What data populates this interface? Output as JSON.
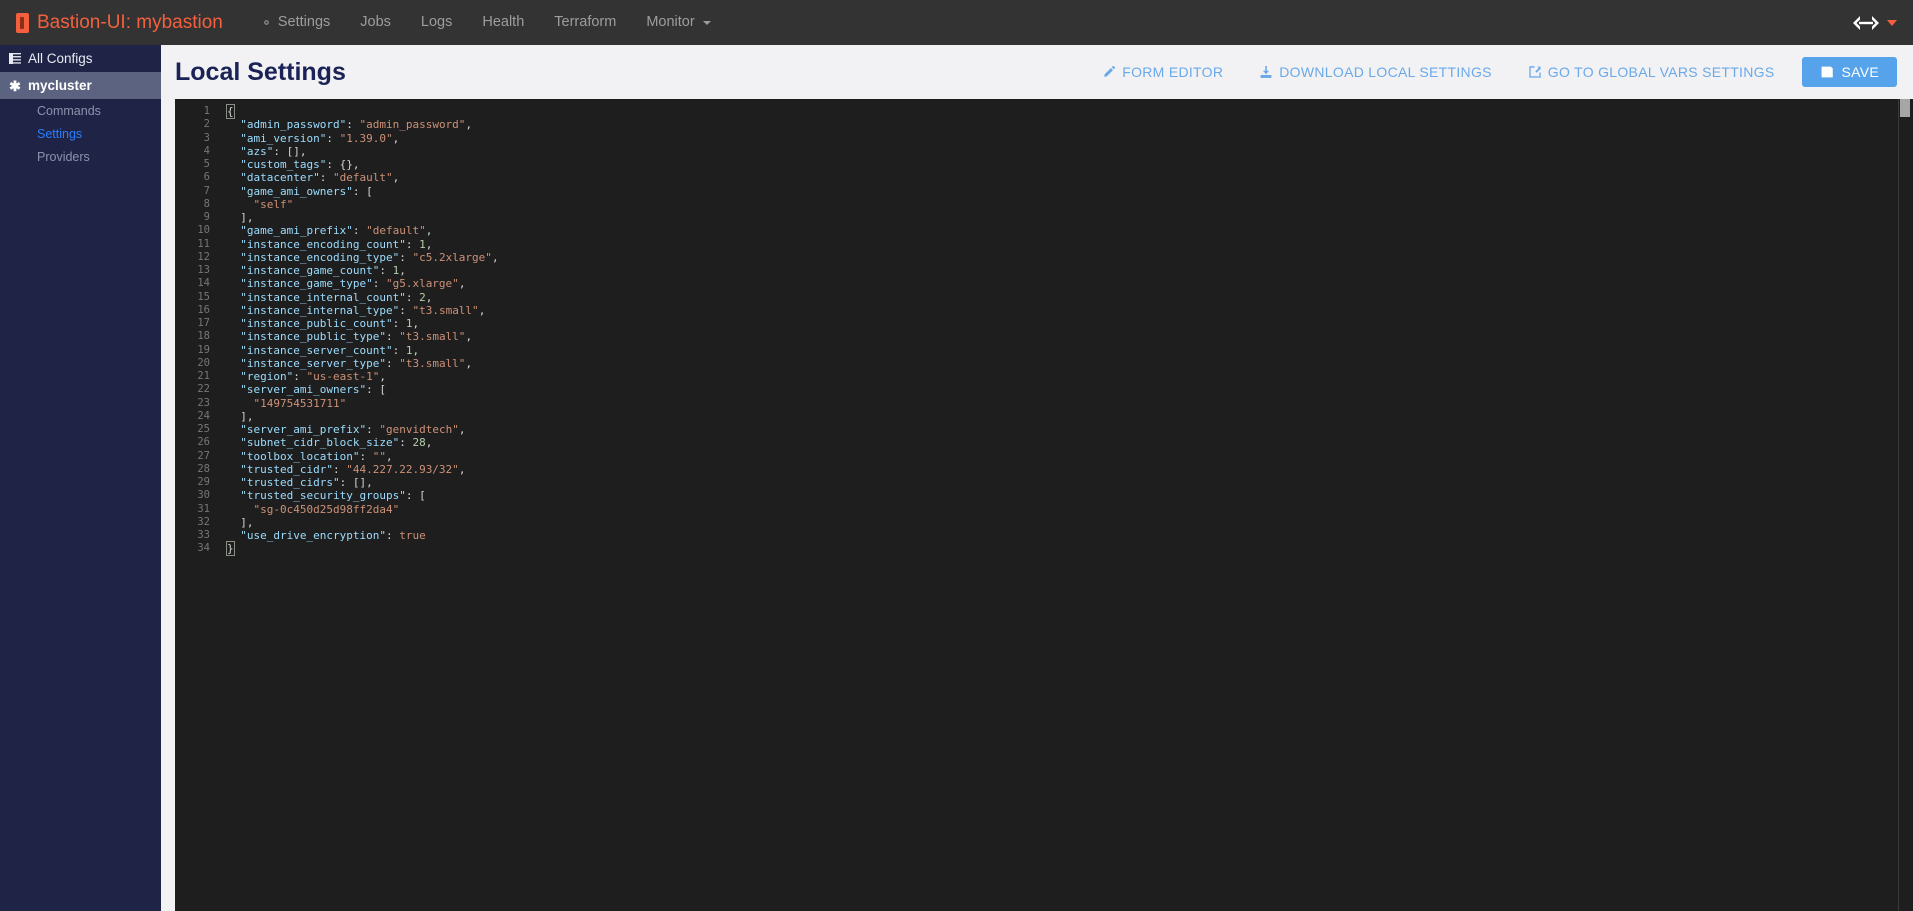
{
  "navbar": {
    "brand_icon": "bastion-logo-icon",
    "brand": "Bastion-UI: mybastion",
    "links": [
      {
        "label": "Settings",
        "icon": "gear-icon",
        "has_caret": false
      },
      {
        "label": "Jobs",
        "icon": null,
        "has_caret": false
      },
      {
        "label": "Logs",
        "icon": null,
        "has_caret": false
      },
      {
        "label": "Health",
        "icon": null,
        "has_caret": false
      },
      {
        "label": "Terraform",
        "icon": null,
        "has_caret": false
      },
      {
        "label": "Monitor",
        "icon": null,
        "has_caret": true
      }
    ],
    "right_logo_icon": "genvid-logo-icon",
    "right_caret_icon": "caret-down-icon",
    "background": "#333333",
    "brand_color": "#f4603e"
  },
  "sidebar": {
    "all_configs": {
      "label": "All Configs",
      "icon": "list-icon"
    },
    "cluster": {
      "label": "mycluster",
      "icon": "asterisk-icon",
      "active": true
    },
    "sub_items": [
      {
        "label": "Commands",
        "active": false
      },
      {
        "label": "Settings",
        "active": true
      },
      {
        "label": "Providers",
        "active": false
      }
    ],
    "background": "#1f2446",
    "active_background": "#5b6380",
    "active_link_color": "#2a7fff"
  },
  "header": {
    "title": "Local Settings",
    "actions": [
      {
        "label": "FORM EDITOR",
        "icon": "pencil-icon"
      },
      {
        "label": "DOWNLOAD LOCAL SETTINGS",
        "icon": "download-icon"
      },
      {
        "label": "GO TO GLOBAL VARS SETTINGS",
        "icon": "edit-square-icon"
      }
    ],
    "save": {
      "label": "SAVE",
      "icon": "floppy-disk-icon",
      "color": "#56a3eb"
    },
    "link_color": "#6aa9e9"
  },
  "editor": {
    "theme_background": "#1e1e1e",
    "line_number_color": "#767676",
    "key_color": "#9cdcfe",
    "string_color": "#ce9178",
    "number_color": "#b5cea8",
    "punctuation_color": "#d4d4d4",
    "total_lines": 34,
    "scrollbar": {
      "position": "top",
      "thumb_color": "#a6a6a6"
    },
    "lines": [
      {
        "n": 1,
        "indent": 0,
        "tokens": [
          {
            "t": "brack",
            "v": "{",
            "match": true
          }
        ]
      },
      {
        "n": 2,
        "indent": 1,
        "tokens": [
          {
            "t": "key",
            "v": "\"admin_password\""
          },
          {
            "t": "punc",
            "v": ": "
          },
          {
            "t": "str",
            "v": "\"admin_password\""
          },
          {
            "t": "punc",
            "v": ","
          }
        ]
      },
      {
        "n": 3,
        "indent": 1,
        "tokens": [
          {
            "t": "key",
            "v": "\"ami_version\""
          },
          {
            "t": "punc",
            "v": ": "
          },
          {
            "t": "str",
            "v": "\"1.39.0\""
          },
          {
            "t": "punc",
            "v": ","
          }
        ]
      },
      {
        "n": 4,
        "indent": 1,
        "tokens": [
          {
            "t": "key",
            "v": "\"azs\""
          },
          {
            "t": "punc",
            "v": ": "
          },
          {
            "t": "brack",
            "v": "[]"
          },
          {
            "t": "punc",
            "v": ","
          }
        ]
      },
      {
        "n": 5,
        "indent": 1,
        "tokens": [
          {
            "t": "key",
            "v": "\"custom_tags\""
          },
          {
            "t": "punc",
            "v": ": "
          },
          {
            "t": "brack",
            "v": "{}"
          },
          {
            "t": "punc",
            "v": ","
          }
        ]
      },
      {
        "n": 6,
        "indent": 1,
        "tokens": [
          {
            "t": "key",
            "v": "\"datacenter\""
          },
          {
            "t": "punc",
            "v": ": "
          },
          {
            "t": "str",
            "v": "\"default\""
          },
          {
            "t": "punc",
            "v": ","
          }
        ]
      },
      {
        "n": 7,
        "indent": 1,
        "tokens": [
          {
            "t": "key",
            "v": "\"game_ami_owners\""
          },
          {
            "t": "punc",
            "v": ": "
          },
          {
            "t": "brack",
            "v": "["
          }
        ]
      },
      {
        "n": 8,
        "indent": 2,
        "tokens": [
          {
            "t": "str",
            "v": "\"self\""
          }
        ]
      },
      {
        "n": 9,
        "indent": 1,
        "tokens": [
          {
            "t": "brack",
            "v": "]"
          },
          {
            "t": "punc",
            "v": ","
          }
        ]
      },
      {
        "n": 10,
        "indent": 1,
        "tokens": [
          {
            "t": "key",
            "v": "\"game_ami_prefix\""
          },
          {
            "t": "punc",
            "v": ": "
          },
          {
            "t": "str",
            "v": "\"default\""
          },
          {
            "t": "punc",
            "v": ","
          }
        ]
      },
      {
        "n": 11,
        "indent": 1,
        "tokens": [
          {
            "t": "key",
            "v": "\"instance_encoding_count\""
          },
          {
            "t": "punc",
            "v": ": "
          },
          {
            "t": "num",
            "v": "1"
          },
          {
            "t": "punc",
            "v": ","
          }
        ]
      },
      {
        "n": 12,
        "indent": 1,
        "tokens": [
          {
            "t": "key",
            "v": "\"instance_encoding_type\""
          },
          {
            "t": "punc",
            "v": ": "
          },
          {
            "t": "str",
            "v": "\"c5.2xlarge\""
          },
          {
            "t": "punc",
            "v": ","
          }
        ]
      },
      {
        "n": 13,
        "indent": 1,
        "tokens": [
          {
            "t": "key",
            "v": "\"instance_game_count\""
          },
          {
            "t": "punc",
            "v": ": "
          },
          {
            "t": "num",
            "v": "1"
          },
          {
            "t": "punc",
            "v": ","
          }
        ]
      },
      {
        "n": 14,
        "indent": 1,
        "tokens": [
          {
            "t": "key",
            "v": "\"instance_game_type\""
          },
          {
            "t": "punc",
            "v": ": "
          },
          {
            "t": "str",
            "v": "\"g5.xlarge\""
          },
          {
            "t": "punc",
            "v": ","
          }
        ]
      },
      {
        "n": 15,
        "indent": 1,
        "tokens": [
          {
            "t": "key",
            "v": "\"instance_internal_count\""
          },
          {
            "t": "punc",
            "v": ": "
          },
          {
            "t": "num",
            "v": "2"
          },
          {
            "t": "punc",
            "v": ","
          }
        ]
      },
      {
        "n": 16,
        "indent": 1,
        "tokens": [
          {
            "t": "key",
            "v": "\"instance_internal_type\""
          },
          {
            "t": "punc",
            "v": ": "
          },
          {
            "t": "str",
            "v": "\"t3.small\""
          },
          {
            "t": "punc",
            "v": ","
          }
        ]
      },
      {
        "n": 17,
        "indent": 1,
        "tokens": [
          {
            "t": "key",
            "v": "\"instance_public_count\""
          },
          {
            "t": "punc",
            "v": ": "
          },
          {
            "t": "num",
            "v": "1"
          },
          {
            "t": "punc",
            "v": ","
          }
        ]
      },
      {
        "n": 18,
        "indent": 1,
        "tokens": [
          {
            "t": "key",
            "v": "\"instance_public_type\""
          },
          {
            "t": "punc",
            "v": ": "
          },
          {
            "t": "str",
            "v": "\"t3.small\""
          },
          {
            "t": "punc",
            "v": ","
          }
        ]
      },
      {
        "n": 19,
        "indent": 1,
        "tokens": [
          {
            "t": "key",
            "v": "\"instance_server_count\""
          },
          {
            "t": "punc",
            "v": ": "
          },
          {
            "t": "num",
            "v": "1"
          },
          {
            "t": "punc",
            "v": ","
          }
        ]
      },
      {
        "n": 20,
        "indent": 1,
        "tokens": [
          {
            "t": "key",
            "v": "\"instance_server_type\""
          },
          {
            "t": "punc",
            "v": ": "
          },
          {
            "t": "str",
            "v": "\"t3.small\""
          },
          {
            "t": "punc",
            "v": ","
          }
        ]
      },
      {
        "n": 21,
        "indent": 1,
        "tokens": [
          {
            "t": "key",
            "v": "\"region\""
          },
          {
            "t": "punc",
            "v": ": "
          },
          {
            "t": "str",
            "v": "\"us-east-1\""
          },
          {
            "t": "punc",
            "v": ","
          }
        ]
      },
      {
        "n": 22,
        "indent": 1,
        "tokens": [
          {
            "t": "key",
            "v": "\"server_ami_owners\""
          },
          {
            "t": "punc",
            "v": ": "
          },
          {
            "t": "brack",
            "v": "["
          }
        ]
      },
      {
        "n": 23,
        "indent": 2,
        "tokens": [
          {
            "t": "str",
            "v": "\"149754531711\""
          }
        ]
      },
      {
        "n": 24,
        "indent": 1,
        "tokens": [
          {
            "t": "brack",
            "v": "]"
          },
          {
            "t": "punc",
            "v": ","
          }
        ]
      },
      {
        "n": 25,
        "indent": 1,
        "tokens": [
          {
            "t": "key",
            "v": "\"server_ami_prefix\""
          },
          {
            "t": "punc",
            "v": ": "
          },
          {
            "t": "str",
            "v": "\"genvidtech\""
          },
          {
            "t": "punc",
            "v": ","
          }
        ]
      },
      {
        "n": 26,
        "indent": 1,
        "tokens": [
          {
            "t": "key",
            "v": "\"subnet_cidr_block_size\""
          },
          {
            "t": "punc",
            "v": ": "
          },
          {
            "t": "num",
            "v": "28"
          },
          {
            "t": "punc",
            "v": ","
          }
        ]
      },
      {
        "n": 27,
        "indent": 1,
        "tokens": [
          {
            "t": "key",
            "v": "\"toolbox_location\""
          },
          {
            "t": "punc",
            "v": ": "
          },
          {
            "t": "str",
            "v": "\"\""
          },
          {
            "t": "punc",
            "v": ","
          }
        ]
      },
      {
        "n": 28,
        "indent": 1,
        "tokens": [
          {
            "t": "key",
            "v": "\"trusted_cidr\""
          },
          {
            "t": "punc",
            "v": ": "
          },
          {
            "t": "str",
            "v": "\"44.227.22.93/32\""
          },
          {
            "t": "punc",
            "v": ","
          }
        ]
      },
      {
        "n": 29,
        "indent": 1,
        "tokens": [
          {
            "t": "key",
            "v": "\"trusted_cidrs\""
          },
          {
            "t": "punc",
            "v": ": "
          },
          {
            "t": "brack",
            "v": "[]"
          },
          {
            "t": "punc",
            "v": ","
          }
        ]
      },
      {
        "n": 30,
        "indent": 1,
        "tokens": [
          {
            "t": "key",
            "v": "\"trusted_security_groups\""
          },
          {
            "t": "punc",
            "v": ": "
          },
          {
            "t": "brack",
            "v": "["
          }
        ]
      },
      {
        "n": 31,
        "indent": 2,
        "tokens": [
          {
            "t": "str",
            "v": "\"sg-0c450d25d98ff2da4\""
          }
        ]
      },
      {
        "n": 32,
        "indent": 1,
        "tokens": [
          {
            "t": "brack",
            "v": "]"
          },
          {
            "t": "punc",
            "v": ","
          }
        ]
      },
      {
        "n": 33,
        "indent": 1,
        "tokens": [
          {
            "t": "key",
            "v": "\"use_drive_encryption\""
          },
          {
            "t": "punc",
            "v": ": "
          },
          {
            "t": "bool",
            "v": "true"
          }
        ]
      },
      {
        "n": 34,
        "indent": 0,
        "tokens": [
          {
            "t": "brack",
            "v": "}",
            "match": true
          }
        ]
      }
    ]
  }
}
